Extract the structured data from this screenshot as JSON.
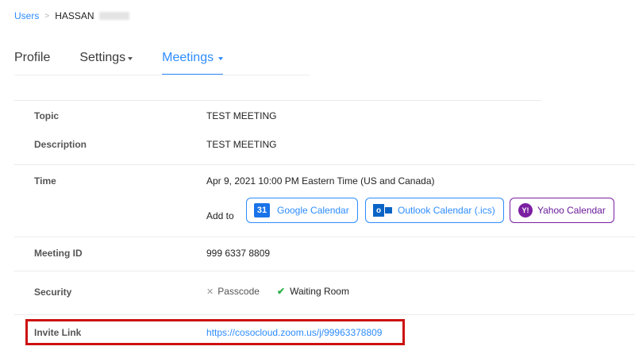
{
  "breadcrumb": {
    "users": "Users",
    "separator": ">",
    "current": "HASSAN"
  },
  "tabs": {
    "profile": "Profile",
    "settings": "Settings",
    "meetings": "Meetings"
  },
  "meeting": {
    "topic_label": "Topic",
    "topic_value": "TEST MEETING",
    "description_label": "Description",
    "description_value": "TEST MEETING",
    "time_label": "Time",
    "time_value": "Apr 9, 2021 10:00 PM Eastern Time (US and Canada)",
    "add_to_label": "Add to",
    "calendar_buttons": {
      "google": "Google Calendar",
      "outlook": "Outlook Calendar (.ics)",
      "yahoo": "Yahoo Calendar"
    },
    "calendar_icons": {
      "google": "31",
      "outlook": "o",
      "yahoo": "Y!"
    },
    "meeting_id_label": "Meeting ID",
    "meeting_id_value": "999 6337 8809",
    "security_label": "Security",
    "security_passcode": "Passcode",
    "security_passcode_enabled": false,
    "security_waiting_room": "Waiting Room",
    "security_waiting_room_enabled": true,
    "invite_label": "Invite Link",
    "invite_value": "https://cosocloud.zoom.us/j/99963378809"
  },
  "colors": {
    "accent": "#2d8cff",
    "yahoo": "#7b1fa2",
    "highlight": "#cc1111",
    "check": "#2cb04a"
  }
}
